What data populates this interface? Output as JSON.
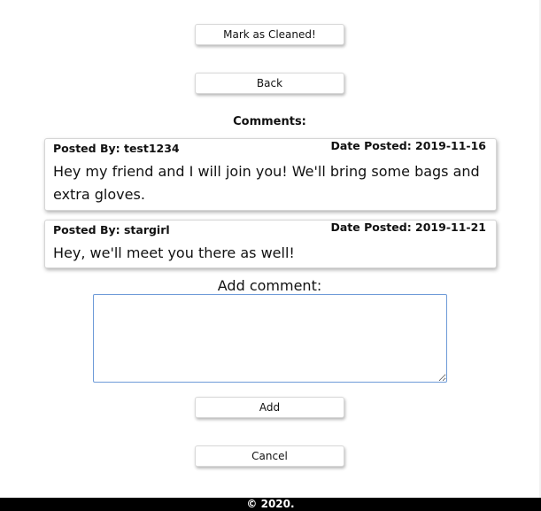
{
  "actions": {
    "mark_cleaned_label": "Mark as Cleaned!",
    "back_label": "Back"
  },
  "comments": {
    "heading": "Comments:",
    "items": [
      {
        "author": "Posted By: test1234",
        "date": "Date Posted: 2019-11-16",
        "text": "Hey my friend and I will join you! We'll bring some bags and extra gloves."
      },
      {
        "author": "Posted By: stargirl",
        "date": "Date Posted: 2019-11-21",
        "text": "Hey, we'll meet you there as well!"
      }
    ]
  },
  "add_comment": {
    "label": "Add comment:",
    "value": "",
    "add_label": "Add",
    "cancel_label": "Cancel"
  },
  "footer": {
    "text": "© 2020."
  }
}
